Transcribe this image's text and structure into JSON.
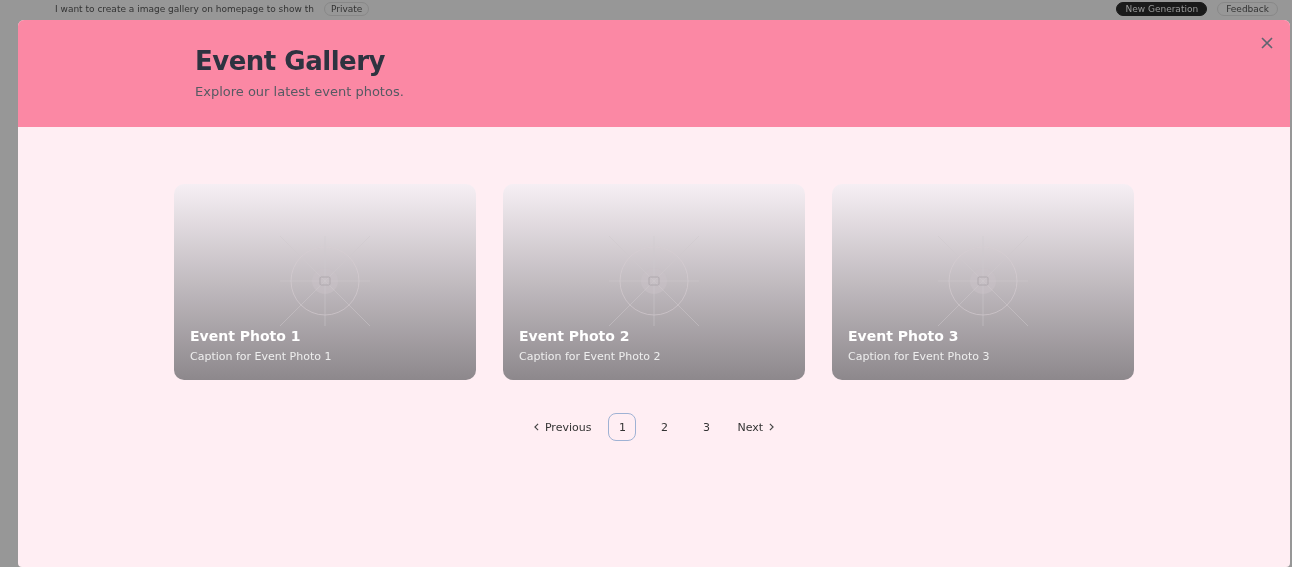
{
  "background": {
    "prompt": "I want to create a image gallery on homepage to show th",
    "visibility": "Private",
    "buttons": [
      "New Generation",
      "Feedback"
    ]
  },
  "modal": {
    "title": "Event Gallery",
    "subtitle": "Explore our latest event photos."
  },
  "photos": [
    {
      "kind": "picture",
      "title": "Event Photo 1",
      "caption": "Caption for Event Photo 1"
    },
    {
      "kind": "picture",
      "title": "Event Photo 2",
      "caption": "Caption for Event Photo 2"
    },
    {
      "kind": "picture",
      "title": "Event Photo 3",
      "caption": "Caption for Event Photo 3"
    }
  ],
  "pagination": {
    "previous": "Previous",
    "next": "Next",
    "pages": [
      {
        "label": "1",
        "selected": true
      },
      {
        "label": "2",
        "selected": false
      },
      {
        "label": "3",
        "selected": false
      }
    ]
  }
}
